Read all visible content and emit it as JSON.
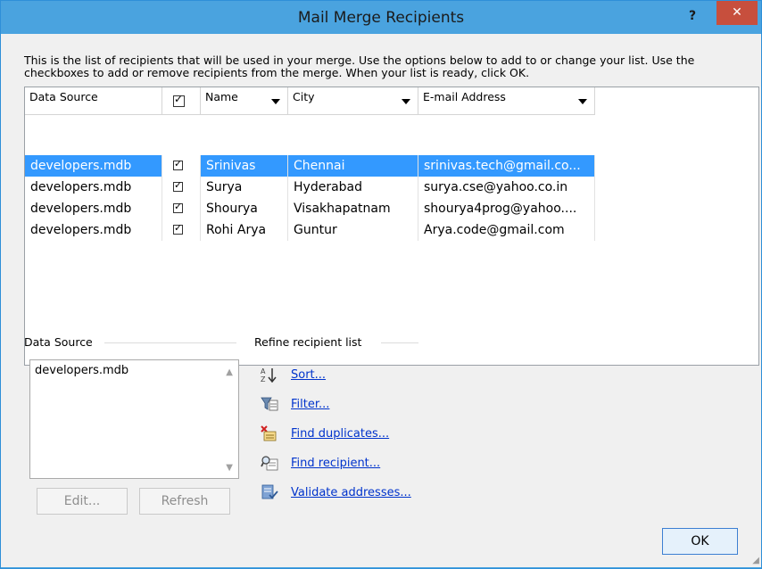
{
  "window": {
    "title": "Mail Merge Recipients",
    "help_label": "?",
    "close_label": "✕"
  },
  "instructions": "This is the list of recipients that will be used in your merge.  Use the options below to add to or change your list.  Use the checkboxes to add or remove recipients from the merge.  When your list is ready, click OK.",
  "grid": {
    "columns": {
      "data_source": "Data Source",
      "name": "Name",
      "city": "City",
      "email": "E-mail Address"
    },
    "rows": [
      {
        "data_source": "developers.mdb",
        "checked": true,
        "name": "Srinivas",
        "city": "Chennai",
        "email": "srinivas.tech@gmail.co...",
        "selected": true
      },
      {
        "data_source": "developers.mdb",
        "checked": true,
        "name": "Surya",
        "city": "Hyderabad",
        "email": "surya.cse@yahoo.co.in",
        "selected": false
      },
      {
        "data_source": "developers.mdb",
        "checked": true,
        "name": "Shourya",
        "city": "Visakhapatnam",
        "email": "shourya4prog@yahoo....",
        "selected": false
      },
      {
        "data_source": "developers.mdb",
        "checked": true,
        "name": "Rohi Arya",
        "city": "Guntur",
        "email": "Arya.code@gmail.com",
        "selected": false
      }
    ]
  },
  "data_source_section": {
    "label": "Data Source",
    "items": [
      "developers.mdb"
    ],
    "edit_label": "Edit...",
    "refresh_label": "Refresh"
  },
  "refine_section": {
    "label": "Refine recipient list",
    "links": [
      {
        "label": "Sort...",
        "icon": "sort-az-icon"
      },
      {
        "label": "Filter...",
        "icon": "filter-icon"
      },
      {
        "label": "Find duplicates...",
        "icon": "find-duplicates-icon"
      },
      {
        "label": "Find recipient...",
        "icon": "find-recipient-icon"
      },
      {
        "label": "Validate addresses...",
        "icon": "validate-addresses-icon"
      }
    ]
  },
  "ok_label": "OK",
  "colors": {
    "titlebar": "#4aa3df",
    "close": "#c74f3d",
    "selection": "#3399ff",
    "link": "#0033cc"
  }
}
